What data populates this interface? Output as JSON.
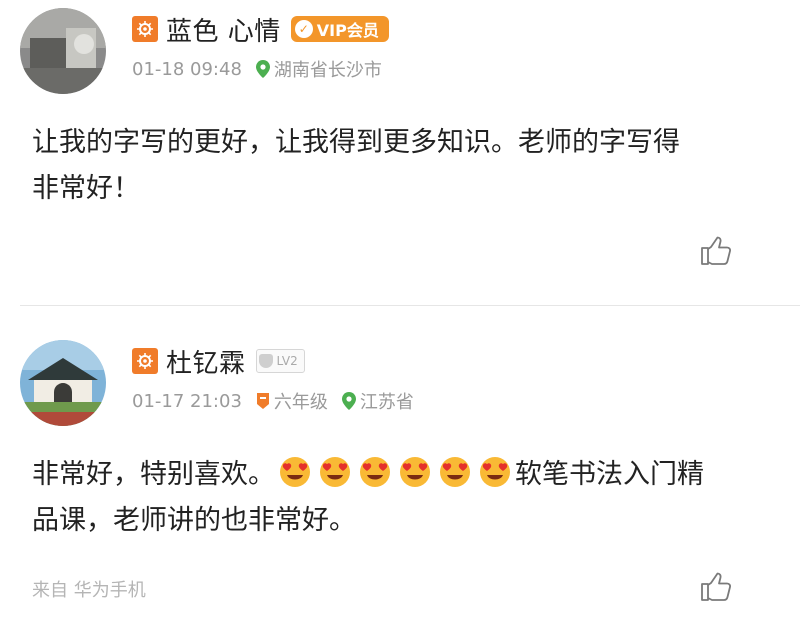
{
  "comments": [
    {
      "username": "蓝色 心情",
      "badge": "VIP会员",
      "time": "01-18 09:48",
      "location": "湖南省长沙市",
      "text": "让我的字写的更好，让我得到更多知识。老师的字写得非常好！",
      "text_line1": "让我的字写的更好，让我得到更多知识。老师的字写得",
      "text_line2": "非常好！"
    },
    {
      "username": "杜钇霖",
      "level": "LV2",
      "time": "01-17 21:03",
      "grade": "六年级",
      "location": "江苏省",
      "text_part1": "非常好，特别喜欢。",
      "emoji_count": 6,
      "text_part2": "软笔书法入门精",
      "text_line2": "品课，老师讲的也非常好。",
      "source": "来自 华为手机"
    }
  ],
  "colors": {
    "orange": "#f07c2a",
    "vip": "#f3962a",
    "location_green": "#4caf50",
    "meta_gray": "#9a9a9a"
  }
}
